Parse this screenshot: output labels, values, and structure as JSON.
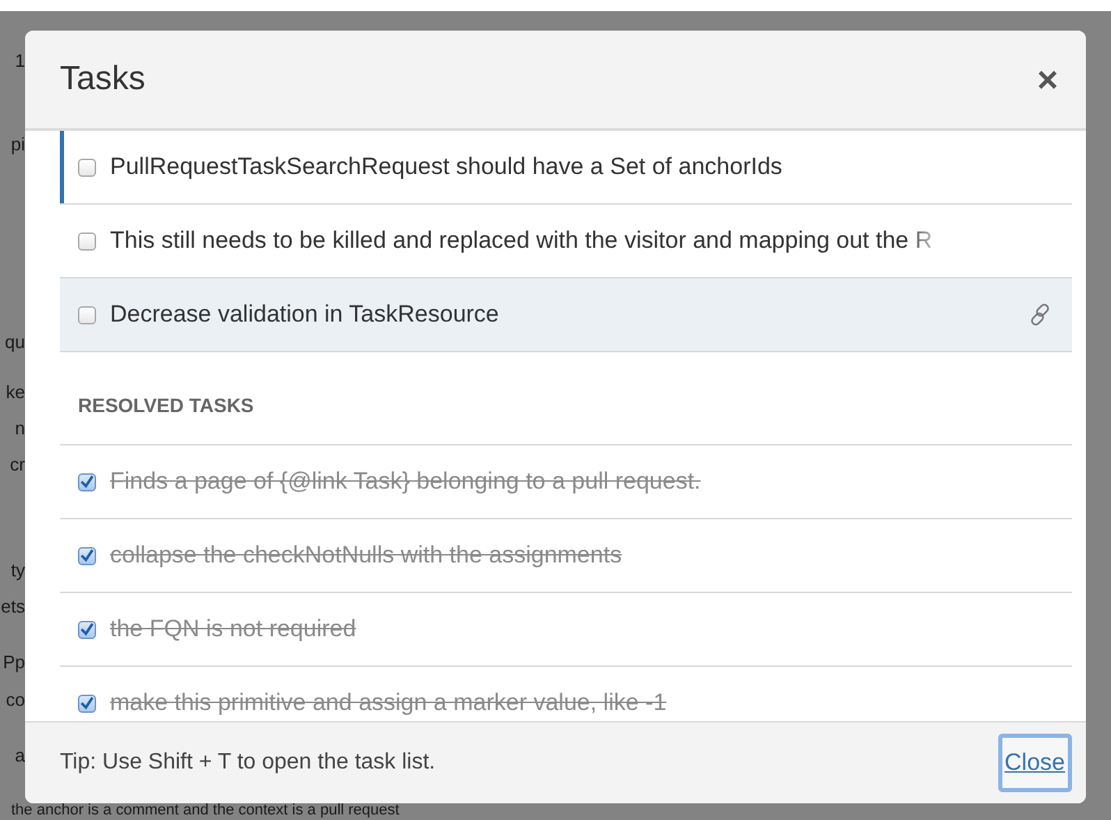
{
  "background": {
    "fragments": [
      "1",
      "pi",
      "qu",
      "ke",
      "n",
      "cr",
      "ty",
      "ets",
      "Pp",
      "co",
      "a"
    ],
    "bottom_line": "the anchor is a comment and the context is a pull request"
  },
  "dialog": {
    "title": "Tasks",
    "close_icon": "×",
    "open_tasks": [
      {
        "text": "PullRequestTaskSearchRequest should have a Set of anchorIds",
        "checked": false,
        "selected": true,
        "hovered": false,
        "faded": false
      },
      {
        "text": "This still needs to be killed and replaced with the visitor and mapping out the R",
        "checked": false,
        "selected": false,
        "hovered": false,
        "faded": true
      },
      {
        "text": "Decrease validation in TaskResource",
        "checked": false,
        "selected": false,
        "hovered": true,
        "faded": false
      }
    ],
    "resolved_heading": "RESOLVED TASKS",
    "resolved_tasks": [
      {
        "text": "Finds a page of {@link Task} belonging to a pull request.",
        "checked": true
      },
      {
        "text": "collapse the checkNotNulls with the assignments",
        "checked": true
      },
      {
        "text": "the FQN is not required",
        "checked": true
      },
      {
        "text": "make this primitive and assign a marker value, like -1",
        "checked": true
      }
    ],
    "tip": "Tip: Use Shift + T to open the task list.",
    "close_button": "Close"
  }
}
